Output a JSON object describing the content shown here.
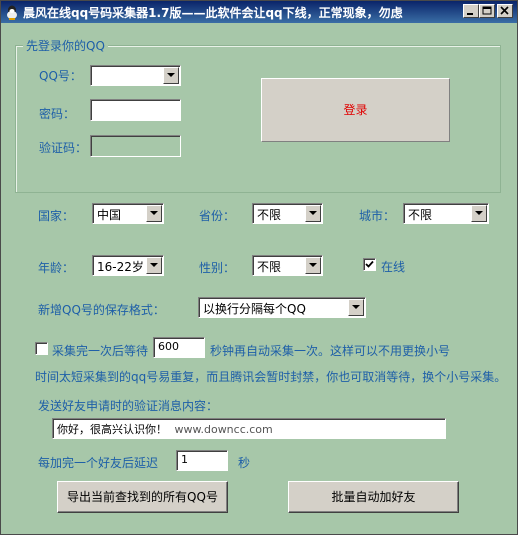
{
  "window": {
    "title": "晨风在线qq号码采集器1.7版——此软件会让qq下线，正常现象，勿虑"
  },
  "login_group": {
    "title": "先登录你的QQ",
    "qq_label": "QQ号：",
    "qq_value": "",
    "password_label": "密码：",
    "password_value": "",
    "captcha_label": "验证码：",
    "captcha_value": "",
    "login_button": "登录",
    "login_color": "#e00000"
  },
  "filters": {
    "country_label": "国家：",
    "country_value": "中国",
    "province_label": "省份：",
    "province_value": "不限",
    "city_label": "城市：",
    "city_value": "不限",
    "age_label": "年龄：",
    "age_value": "16-22岁",
    "gender_label": "性别：",
    "gender_value": "不限",
    "online_label": "在线",
    "online_checked": true
  },
  "save_format": {
    "label": "新增QQ号的保存格式：",
    "value": "以换行分隔每个QQ"
  },
  "wait": {
    "prefix": "采集完一次后等待",
    "seconds": "600",
    "suffix": "秒钟再自动采集一次。这样可以不用更换小号",
    "line2": "时间太短采集到的qq号易重复，而且腾讯会暂时封禁，你也可取消等待，换个小号采集。",
    "checked": false
  },
  "verify": {
    "label": "发送好友申请时的验证消息内容：",
    "message": "你好，很高兴认识你！",
    "watermark": "www.downcc.com"
  },
  "delay": {
    "label": "每加完一个好友后延迟",
    "value": "1",
    "unit": "秒"
  },
  "buttons": {
    "export": "导出当前查找到的所有QQ号",
    "batch_add": "批量自动加好友"
  },
  "colors": {
    "background": "#a7c7a9",
    "label_blue": "#1e5fa8",
    "title_bar": "#0a246a"
  }
}
